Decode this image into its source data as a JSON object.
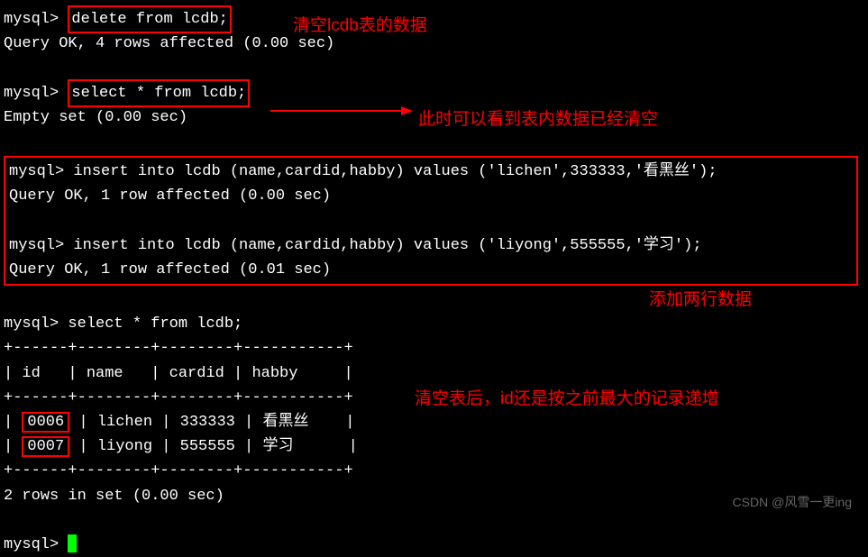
{
  "prompt": "mysql> ",
  "commands": {
    "delete": "delete from lcdb;",
    "delete_result": "Query OK, 4 rows affected (0.00 sec)",
    "select1": "select * from lcdb;",
    "select1_result": "Empty set (0.00 sec)",
    "insert1": "insert into lcdb (name,cardid,habby) values ('lichen',333333,'看黑丝');",
    "insert1_result": "Query OK, 1 row affected (0.00 sec)",
    "insert2": "insert into lcdb (name,cardid,habby) values ('liyong',555555,'学习');",
    "insert2_result": "Query OK, 1 row affected (0.01 sec)",
    "select2": "select * from lcdb;"
  },
  "table": {
    "border": "+------+--------+--------+-----------+",
    "header": "| id   | name   | cardid | habby     |",
    "row1_pre": "| ",
    "row1_id": "0006",
    "row1_rest": " | lichen | 333333 | 看黑丝    |",
    "row2_pre": "| ",
    "row2_id": "0007",
    "row2_rest": " | liyong | 555555 | 学习      |",
    "footer": "2 rows in set (0.00 sec)"
  },
  "annotations": {
    "a1": "清空lcdb表的数据",
    "a2": "此时可以看到表内数据已经清空",
    "a3": "添加两行数据",
    "a4": "清空表后，id还是按之前最大的记录递增"
  },
  "watermark": "CSDN @风雪一更ing"
}
